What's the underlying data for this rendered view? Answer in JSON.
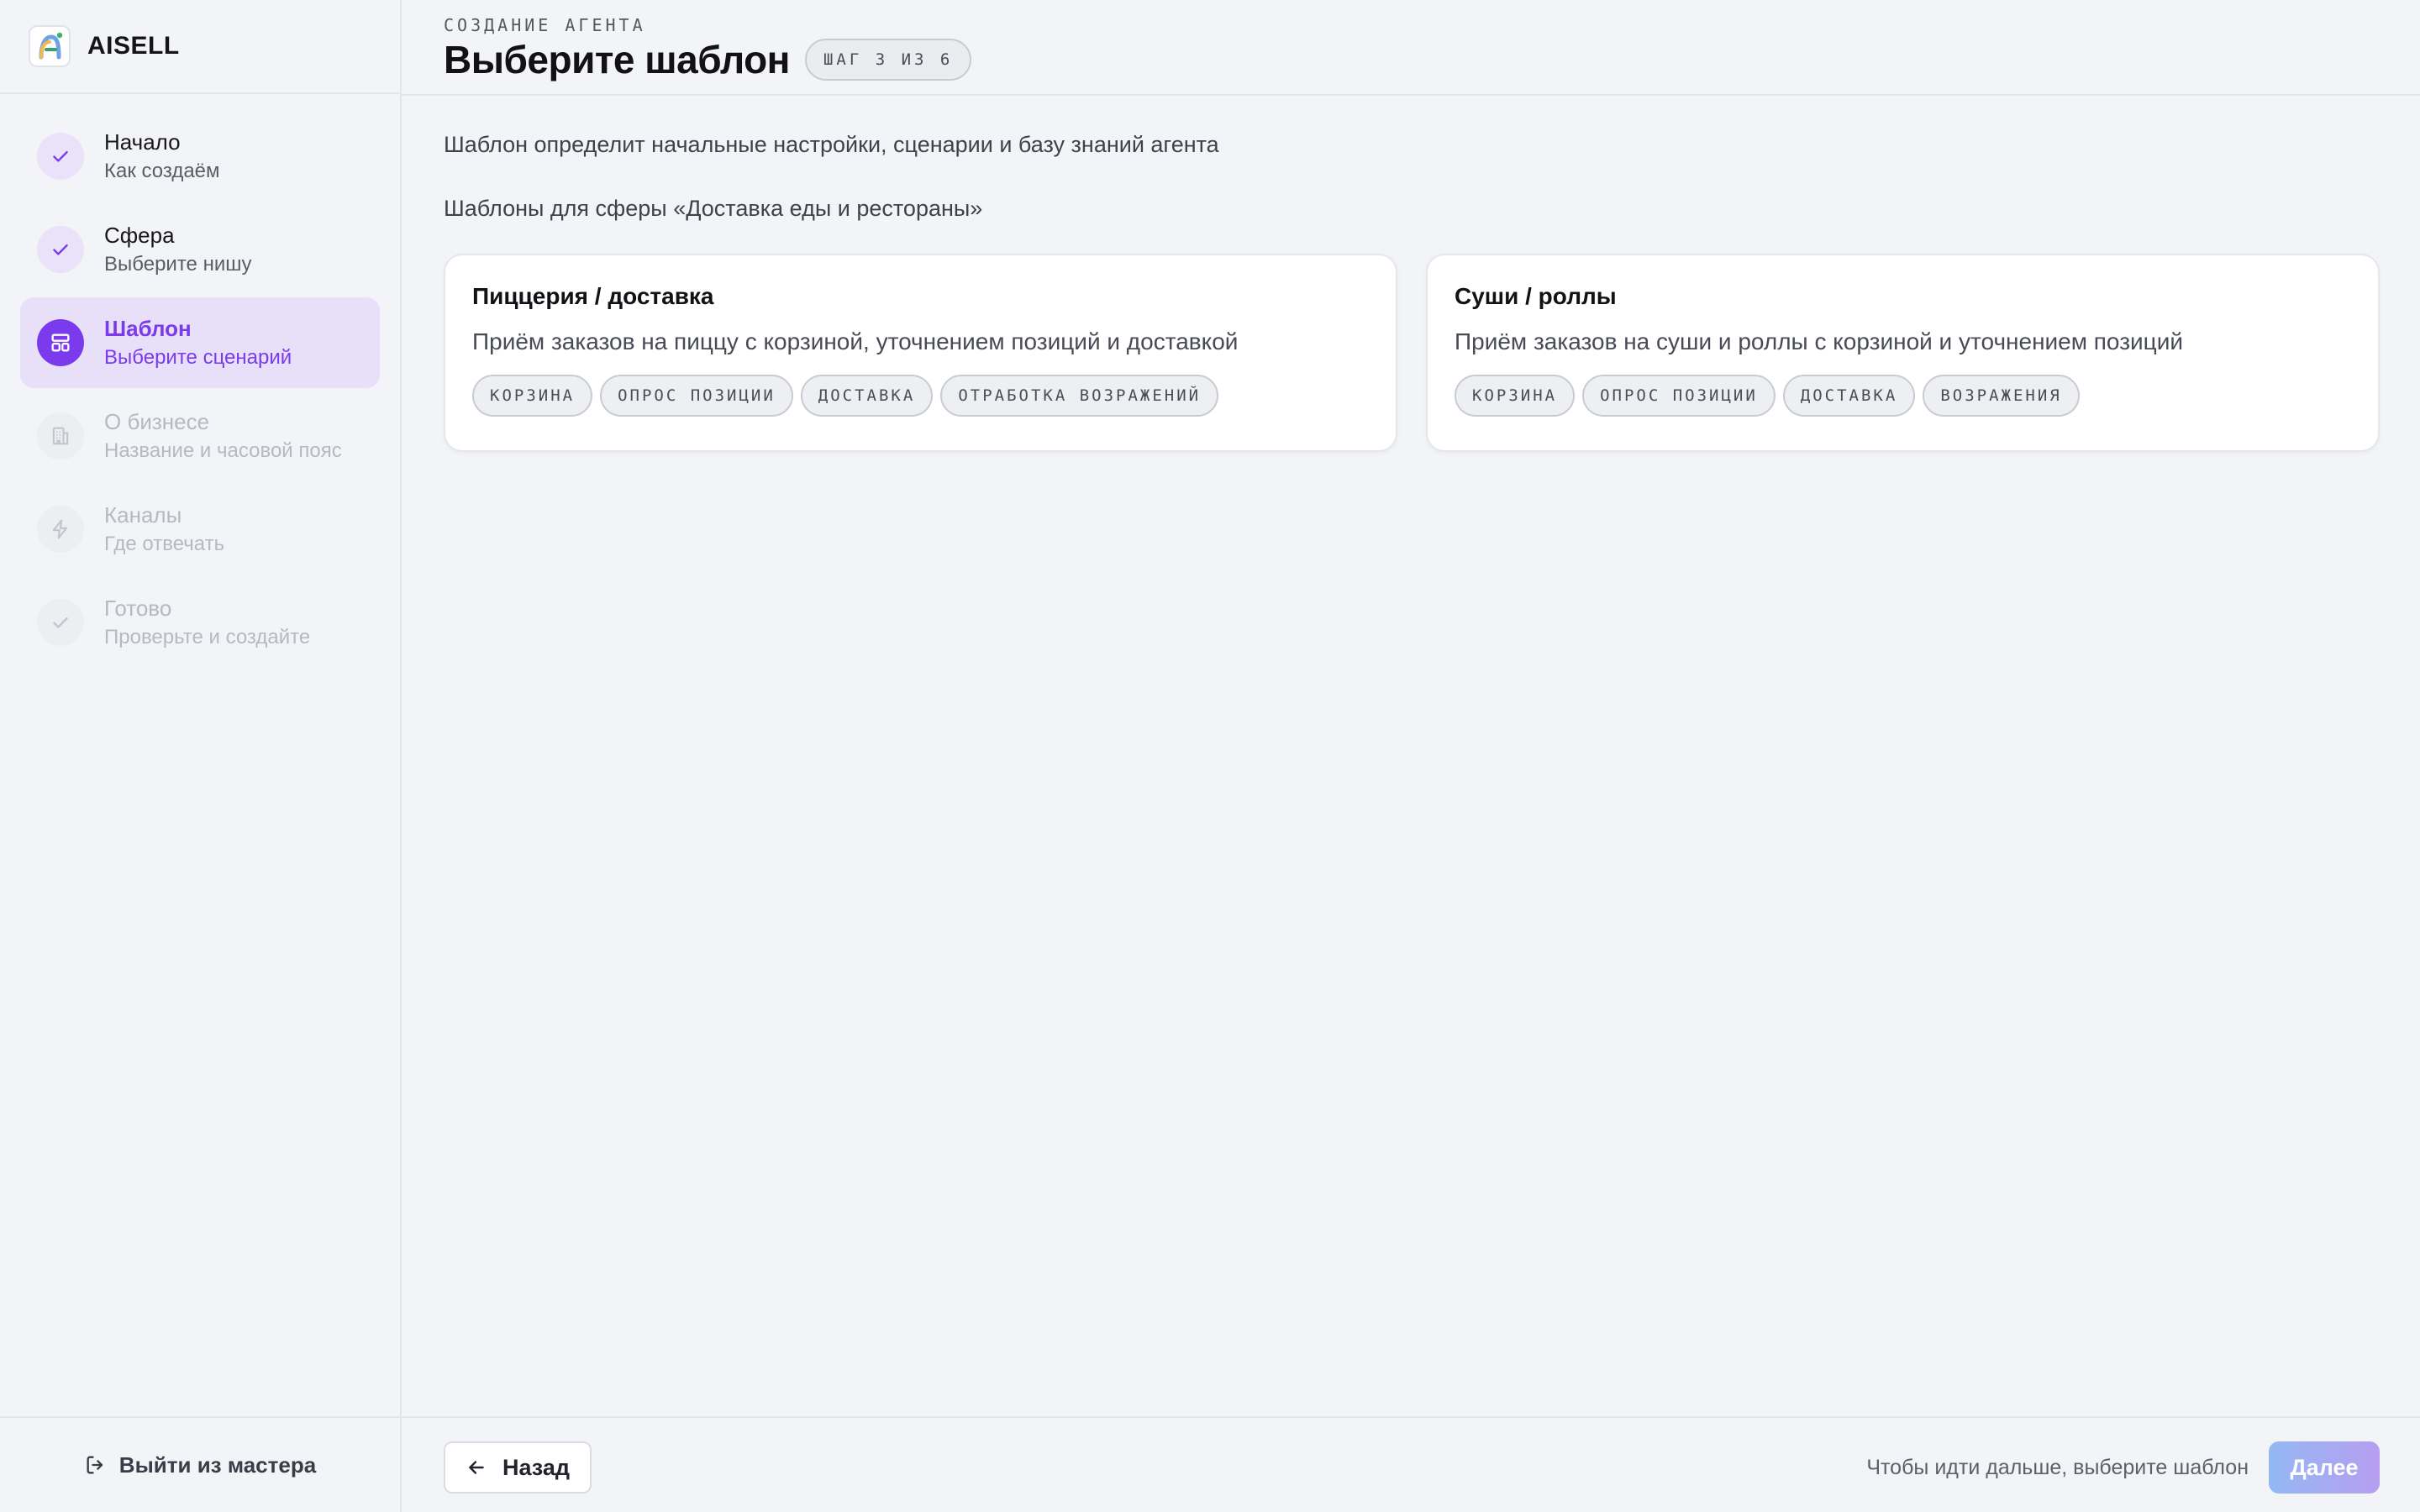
{
  "brand": {
    "name": "AISELL"
  },
  "steps": [
    {
      "title": "Начало",
      "subtitle": "Как создаём",
      "state": "done",
      "icon": "check-icon"
    },
    {
      "title": "Сфера",
      "subtitle": "Выберите нишу",
      "state": "done",
      "icon": "check-icon"
    },
    {
      "title": "Шаблон",
      "subtitle": "Выберите сценарий",
      "state": "active",
      "icon": "template-icon"
    },
    {
      "title": "О бизнесе",
      "subtitle": "Название и часовой пояс",
      "state": "todo",
      "icon": "building-icon"
    },
    {
      "title": "Каналы",
      "subtitle": "Где отвечать",
      "state": "todo",
      "icon": "lightning-icon"
    },
    {
      "title": "Готово",
      "subtitle": "Проверьте и создайте",
      "state": "todo",
      "icon": "check-icon"
    }
  ],
  "sidebar": {
    "exit_label": "Выйти из мастера"
  },
  "header": {
    "eyebrow": "СОЗДАНИЕ АГЕНТА",
    "title": "Выберите шаблон",
    "step_badge": "ШАГ 3 ИЗ 6"
  },
  "main": {
    "description": "Шаблон определит начальные настройки, сценарии и базу знаний агента",
    "sphere_label": "Шаблоны для сферы «Доставка еды и рестораны»",
    "cards": [
      {
        "title": "Пиццерия / доставка",
        "description": "Приём заказов на пиццу с корзиной, уточнением позиций и доставкой",
        "tags": [
          "КОРЗИНА",
          "ОПРОС ПОЗИЦИИ",
          "ДОСТАВКА",
          "ОТРАБОТКА ВОЗРАЖЕНИЙ"
        ]
      },
      {
        "title": "Суши / роллы",
        "description": "Приём заказов на суши и роллы с корзиной и уточнением позиций",
        "tags": [
          "КОРЗИНА",
          "ОПРОС ПОЗИЦИИ",
          "ДОСТАВКА",
          "ВОЗРАЖЕНИЯ"
        ]
      }
    ]
  },
  "footer": {
    "back_label": "Назад",
    "hint": "Чтобы идти дальше, выберите шаблон",
    "next_label": "Далее"
  },
  "colors": {
    "accent": "#7c3aed",
    "background": "#f3f4f7",
    "card": "#ffffff",
    "next_gradient_start": "#93b8f4",
    "next_gradient_end": "#b79ef0"
  }
}
